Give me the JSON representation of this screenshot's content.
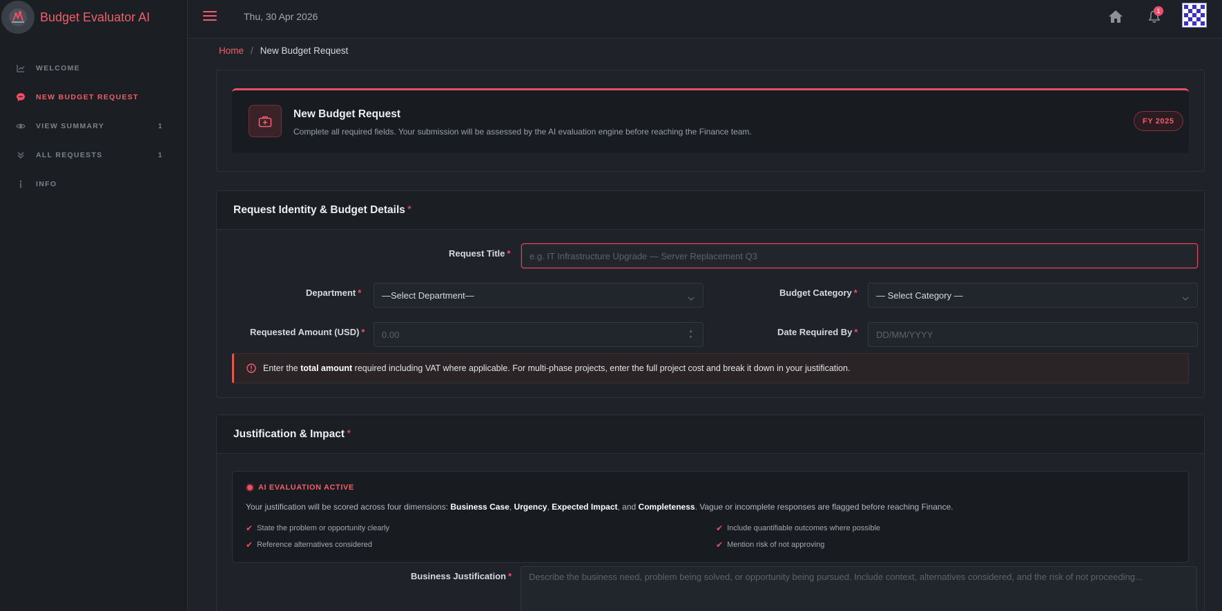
{
  "app": {
    "name": "Budget Evaluator AI",
    "date": "Thu, 30 Apr 2026",
    "notification_count": "1",
    "accent": "#ef5f6b"
  },
  "sidebar": {
    "items": [
      {
        "label": "WELCOME",
        "icon": "chart-line-icon",
        "count": ""
      },
      {
        "label": "NEW BUDGET REQUEST",
        "icon": "chat-bubble-icon",
        "count": ""
      },
      {
        "label": "VIEW SUMMARY",
        "icon": "eye-icon",
        "count": "1"
      },
      {
        "label": "ALL REQUESTS",
        "icon": "chevrons-down-icon",
        "count": "1"
      },
      {
        "label": "INFO",
        "icon": "info-icon",
        "count": ""
      }
    ]
  },
  "breadcrumb": {
    "home": "Home",
    "separator": "/",
    "current": "New Budget Request"
  },
  "hero": {
    "title": "New Budget Request",
    "subtitle": "Complete all required fields. Your submission will be assessed by the AI evaluation engine before reaching the Finance team.",
    "fiscal_year": "FY 2025"
  },
  "section_identity": {
    "title": "Request Identity & Budget Details",
    "required_mark": "*",
    "request_title_label": "Request Title",
    "request_title_placeholder": "e.g. IT Infrastructure Upgrade — Server Replacement Q3",
    "department_label": "Department",
    "department_value": "—Select Department—",
    "category_label": "Budget Category",
    "category_value": "— Select Category —",
    "amount_label": "Requested Amount (USD)",
    "amount_placeholder": "0.00",
    "date_label": "Date Required By",
    "date_placeholder": "DD/MM/YYYY",
    "alert_pre": "Enter the ",
    "alert_bold": "total amount",
    "alert_post": " required including VAT where applicable. For multi-phase projects, enter the full project cost and break it down in your justification."
  },
  "section_justification": {
    "title": "Justification & Impact",
    "required_mark": "*",
    "ai_status": "AI EVALUATION ACTIVE",
    "ai_desc_pre": "Your justification will be scored across four dimensions: ",
    "dim1": "Business Case",
    "sep1": ", ",
    "dim2": "Urgency",
    "sep2": ", ",
    "dim3": "Expected Impact",
    "sep3": ", and ",
    "dim4": "Completeness",
    "ai_desc_post": ". Vague or incomplete responses are flagged before reaching Finance.",
    "tips": [
      "State the problem or opportunity clearly",
      "Include quantifiable outcomes where possible",
      "Reference alternatives considered",
      "Mention risk of not approving"
    ],
    "business_justification_label": "Business Justification",
    "business_justification_placeholder": "Describe the business need, problem being solved, or opportunity being pursued. Include context, alternatives considered, and the risk of not proceeding..."
  }
}
